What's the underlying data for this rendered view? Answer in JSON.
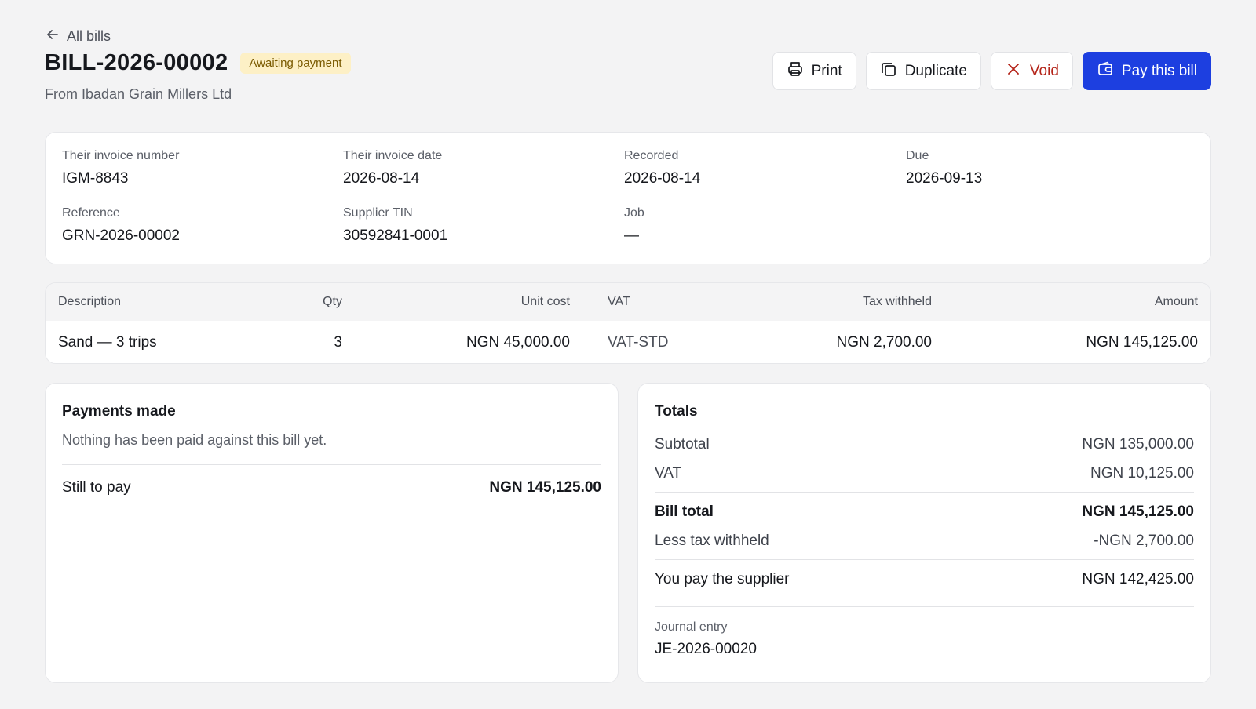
{
  "header": {
    "back_label": "All bills",
    "title": "BILL-2026-00002",
    "status": "Awaiting payment",
    "subtitle": "From Ibadan Grain Millers Ltd"
  },
  "actions": {
    "print": "Print",
    "duplicate": "Duplicate",
    "void": "Void",
    "pay": "Pay this bill"
  },
  "details": [
    {
      "label": "Their invoice number",
      "value": "IGM-8843"
    },
    {
      "label": "Their invoice date",
      "value": "2026-08-14"
    },
    {
      "label": "Recorded",
      "value": "2026-08-14"
    },
    {
      "label": "Due",
      "value": "2026-09-13"
    },
    {
      "label": "Reference",
      "value": "GRN-2026-00002"
    },
    {
      "label": "Supplier TIN",
      "value": "30592841-0001"
    },
    {
      "label": "Job",
      "value": "—"
    }
  ],
  "lines": {
    "columns": [
      "Description",
      "Qty",
      "Unit cost",
      "VAT",
      "Tax withheld",
      "Amount"
    ],
    "rows": [
      [
        "Sand — 3 trips",
        "3",
        "NGN 45,000.00",
        "VAT-STD",
        "NGN 2,700.00",
        "NGN 145,125.00"
      ]
    ]
  },
  "payments": {
    "title": "Payments made",
    "empty_note": "Nothing has been paid against this bill yet.",
    "still_label": "Still to pay",
    "still_value": "NGN 145,125.00"
  },
  "totals": {
    "title": "Totals",
    "subtotal_label": "Subtotal",
    "subtotal_value": "NGN 135,000.00",
    "vat_label": "VAT",
    "vat_value": "NGN 10,125.00",
    "bill_total_label": "Bill total",
    "bill_total_value": "NGN 145,125.00",
    "withheld_label": "Less tax withheld",
    "withheld_value": "-NGN 2,700.00",
    "you_pay_label": "You pay the supplier",
    "you_pay_value": "NGN 142,425.00",
    "journal_label": "Journal entry",
    "journal_value": "JE-2026-00020"
  },
  "colors": {
    "primary": "#1d3fe0",
    "void": "#b42318",
    "badge_bg": "#fdf0c6",
    "badge_text": "#7a5a00"
  }
}
